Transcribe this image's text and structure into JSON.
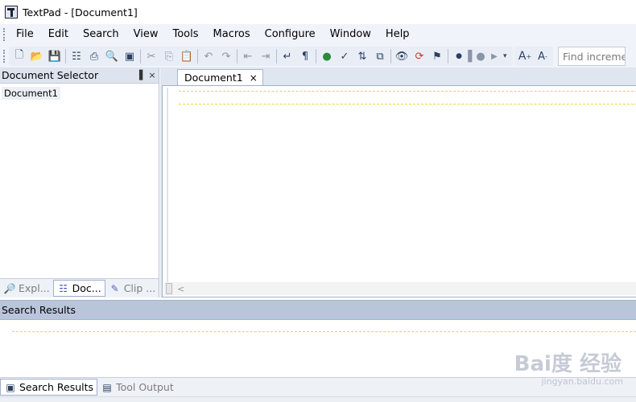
{
  "window": {
    "title": "TextPad - [Document1]"
  },
  "menubar": {
    "items": [
      "File",
      "Edit",
      "Search",
      "View",
      "Tools",
      "Macros",
      "Configure",
      "Window",
      "Help"
    ]
  },
  "toolbar": {
    "find_placeholder": "Find increment",
    "font_larger": "A",
    "font_smaller": "A"
  },
  "document_selector": {
    "title": "Document Selector",
    "pin_glyph": "▐",
    "close_glyph": "×",
    "items": [
      "Document1"
    ],
    "tabs": [
      "Expl...",
      "Doc...",
      "Clip ..."
    ]
  },
  "editor": {
    "tabs": [
      {
        "label": "Document1",
        "close_glyph": "×"
      }
    ],
    "scroll_arrow": "<"
  },
  "search_results": {
    "title": "Search Results"
  },
  "bottom_tabs": [
    "Search Results",
    "Tool Output"
  ],
  "watermark": {
    "text": "Bai度 经验",
    "url": "jingyan.baidu.com"
  },
  "colors": {
    "menubar_bg": "#f0f3f9",
    "panel_header": "#dde4ef",
    "search_header": "#b9c6da",
    "dashed_line": "#e8d34c"
  }
}
